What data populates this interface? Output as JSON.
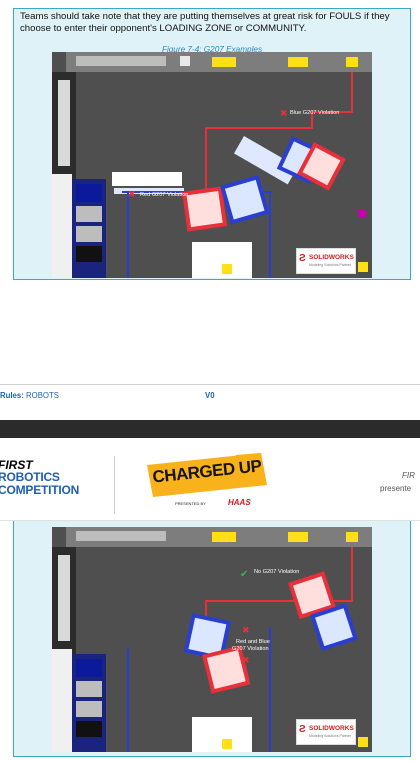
{
  "callout": {
    "text": "Teams should take note that they are putting themselves at great risk for FOULS if they choose to enter their opponent's LOADING ZONE or COMMUNITY.",
    "caption": "Figure 7-4: G207 Examples"
  },
  "figure1": {
    "label_blue": "Blue G207 Violation",
    "label_red": "Red G207 Violation",
    "sponsor_name": "SOLIDWORKS",
    "sponsor_sub": "Modeling Solutions Partner"
  },
  "footer": {
    "section_key": "Rules:",
    "section_value": "ROBOTS",
    "version": "V0"
  },
  "header": {
    "first_line1": "FIRST",
    "first_line2": "ROBOTICS",
    "first_line3": "COMPETITION",
    "game_title": "CHARGED UP",
    "presented_by": "PRESENTED BY",
    "sponsor": "HAAS",
    "right_first": "FIR",
    "right_presented": "presente"
  },
  "figure2": {
    "label_ok": "No G207 Violation",
    "label_both_1": "Red and Blue",
    "label_both_2": "G207 Violation",
    "sponsor_name": "SOLIDWORKS",
    "sponsor_sub": "Modeling Solutions Partner"
  },
  "colors": {
    "accent_blue": "#1f62b0",
    "callout_bg": "#dff2f7",
    "callout_border": "#3aa7cc",
    "alliance_red": "#e8303a",
    "alliance_blue": "#2a3fd0",
    "carpet": "#4f4f4f"
  }
}
